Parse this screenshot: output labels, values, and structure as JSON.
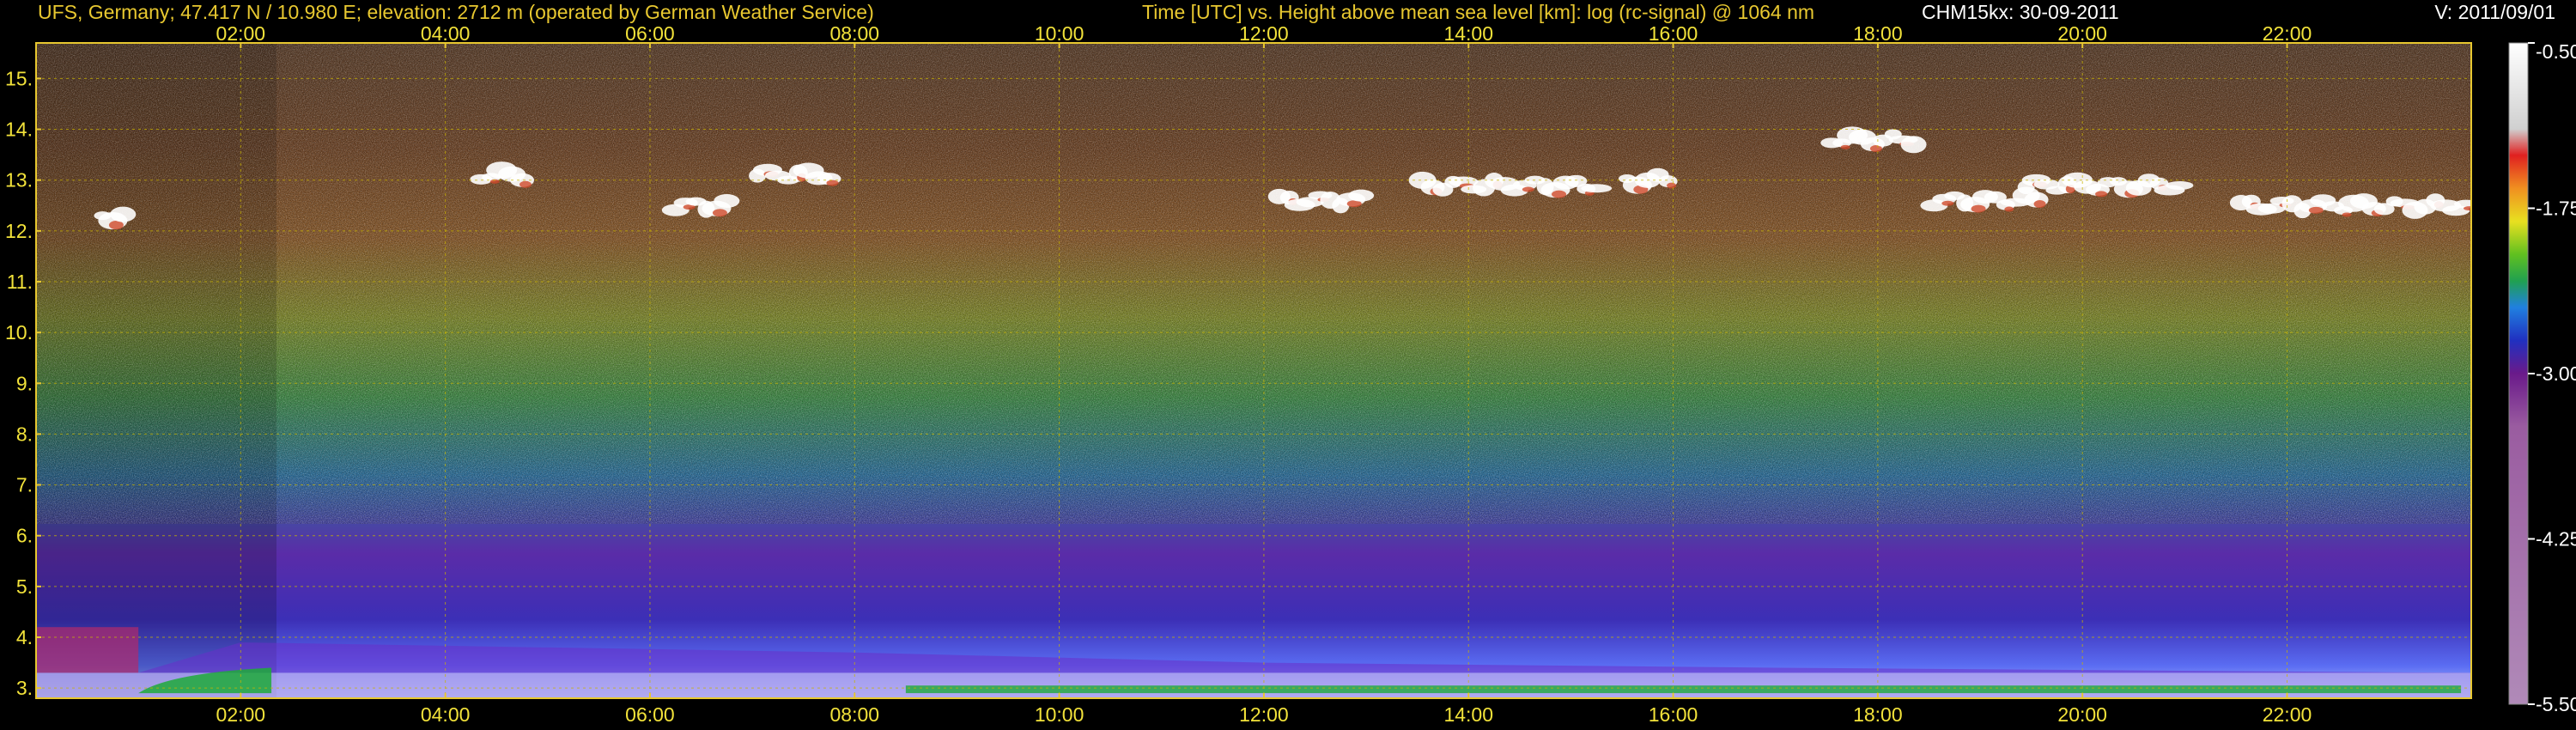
{
  "header": {
    "station": "UFS, Germany; 47.417 N / 10.980 E; elevation: 2712 m  (operated by German Weather Service)",
    "title": "Time [UTC] vs. Height above mean sea level [km]: log (rc-signal) @ 1064 nm",
    "instrument": "CHM15kx: 30-09-2011",
    "version": "V: 2011/09/01"
  },
  "colors": {
    "axis": "#e8c830",
    "grid": "#c8b400",
    "text_yellow": "#f2e23a",
    "text_white": "#ffffff",
    "background": "#000000",
    "aerosol_layer": "#6a2ec8",
    "low_layer_violet": "#b22a6a",
    "surface_layer": "#1faa3a",
    "cirrus": "#ffffff"
  },
  "chart_data": {
    "type": "heatmap",
    "title": "Time [UTC] vs. Height above mean sea level [km]: log (rc-signal) @ 1064 nm",
    "xlabel": "Time [UTC]",
    "ylabel": "Height above mean sea level [km]",
    "x_range_hours": [
      0.0,
      23.8
    ],
    "y_range_km": [
      2.8,
      15.7
    ],
    "x_ticks": [
      "02:00",
      "04:00",
      "06:00",
      "08:00",
      "10:00",
      "12:00",
      "14:00",
      "16:00",
      "18:00",
      "20:00",
      "22:00"
    ],
    "x_tick_hours": [
      2,
      4,
      6,
      8,
      10,
      12,
      14,
      16,
      18,
      20,
      22
    ],
    "y_ticks": [
      "3.",
      "4.",
      "5.",
      "6.",
      "7.",
      "8.",
      "9.",
      "10.",
      "11.",
      "12.",
      "13.",
      "14.",
      "15."
    ],
    "y_tick_km": [
      3,
      4,
      5,
      6,
      7,
      8,
      9,
      10,
      11,
      12,
      13,
      14,
      15
    ],
    "grid": true,
    "colorbar": {
      "label": "log (rc-signal)",
      "ticks": [
        "-0.50",
        "-1.75",
        "-3.00",
        "-4.25",
        "-5.50"
      ],
      "tick_values": [
        -0.5,
        -1.75,
        -3.0,
        -4.25,
        -5.5
      ],
      "range": [
        -5.5,
        -0.5
      ],
      "placement": "right"
    },
    "cloud_layers": [
      {
        "start_h": 0.6,
        "end_h": 0.9,
        "height_km": 12.3
      },
      {
        "start_h": 4.3,
        "end_h": 4.8,
        "height_km": 13.1
      },
      {
        "start_h": 6.2,
        "end_h": 6.8,
        "height_km": 12.5
      },
      {
        "start_h": 7.0,
        "end_h": 7.8,
        "height_km": 13.1
      },
      {
        "start_h": 12.1,
        "end_h": 13.0,
        "height_km": 12.6
      },
      {
        "start_h": 13.5,
        "end_h": 15.3,
        "height_km": 12.9
      },
      {
        "start_h": 15.5,
        "end_h": 16.0,
        "height_km": 13.0
      },
      {
        "start_h": 17.5,
        "end_h": 18.4,
        "height_km": 13.8
      },
      {
        "start_h": 18.5,
        "end_h": 19.6,
        "height_km": 12.6
      },
      {
        "start_h": 19.4,
        "end_h": 21.0,
        "height_km": 12.9
      },
      {
        "start_h": 21.5,
        "end_h": 23.8,
        "height_km": 12.5
      }
    ],
    "boundary_layer_top_km": [
      {
        "h": 0.0,
        "km": 3.3
      },
      {
        "h": 1.0,
        "km": 3.3
      },
      {
        "h": 2.0,
        "km": 3.9
      },
      {
        "h": 8.0,
        "km": 3.7
      },
      {
        "h": 12.0,
        "km": 3.5
      },
      {
        "h": 17.0,
        "km": 3.4
      },
      {
        "h": 23.8,
        "km": 3.3
      }
    ]
  }
}
